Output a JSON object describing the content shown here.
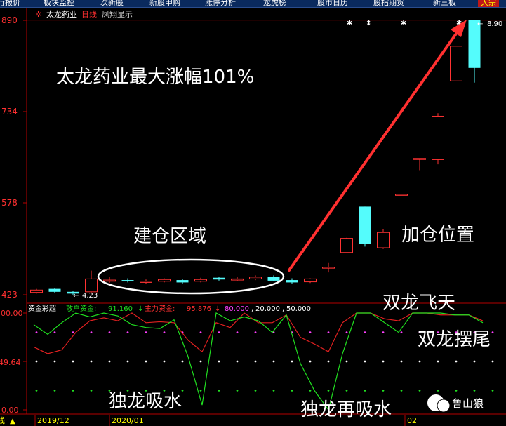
{
  "tabs": [
    {
      "label": "行报价",
      "active": false
    },
    {
      "label": "板块监控",
      "active": false
    },
    {
      "label": "次新股",
      "active": false
    },
    {
      "label": "新股申购",
      "active": false
    },
    {
      "label": "涨停分析",
      "active": false
    },
    {
      "label": "龙虎榜",
      "active": false
    },
    {
      "label": "股市日历",
      "active": false
    },
    {
      "label": "股指期货",
      "active": false
    },
    {
      "label": "新三板",
      "active": false
    },
    {
      "label": "大宗",
      "active": true
    }
  ],
  "chart_header": {
    "title": "太龙药业",
    "period": "日线",
    "mode": "凤翔显示"
  },
  "price_axis": {
    "labels": [
      "890",
      "734",
      "578",
      "423"
    ]
  },
  "last_price": "8.90",
  "low_mark": "4.23",
  "indicator": {
    "name": "资金彩超",
    "sanhu_label": "散户资金:",
    "sanhu_value": "91.160",
    "zhuli_label": "主力资金:",
    "zhuli_value": "95.876",
    "levels": [
      "80.000",
      "20.000",
      "50.000"
    ],
    "axis_labels": [
      "100.00",
      "49.64",
      "0.00"
    ]
  },
  "time_axis": {
    "labels": [
      "2019/12",
      "2020/01",
      "02"
    ]
  },
  "annotations": {
    "max_gain": "太龙药业最大涨幅101%",
    "build_zone": "建仓区域",
    "add_position": "加仓位置",
    "double_dragon_fly": "双龙飞天",
    "double_dragon_swing": "双龙摆尾",
    "single_dragon": "独龙吸水",
    "single_dragon_again": "独龙再吸水",
    "watermark": "鲁山狼"
  },
  "colors": {
    "up": "#ff3232",
    "down": "#54fcfc",
    "green_line": "#20e020",
    "red_line": "#e02020",
    "arrow": "#ff3030",
    "axis_red": "#b40000"
  },
  "chart_data": {
    "type": "candlestick",
    "price_range": [
      4.23,
      8.9
    ],
    "candles": [
      {
        "o": 4.27,
        "c": 4.31,
        "h": 4.33,
        "l": 4.25
      },
      {
        "o": 4.33,
        "c": 4.28,
        "h": 4.35,
        "l": 4.26
      },
      {
        "o": 4.28,
        "c": 4.25,
        "h": 4.3,
        "l": 4.23
      },
      {
        "o": 4.28,
        "c": 4.5,
        "h": 4.64,
        "l": 4.26
      },
      {
        "o": 4.46,
        "c": 4.48,
        "h": 4.53,
        "l": 4.43
      },
      {
        "o": 4.48,
        "c": 4.46,
        "h": 4.51,
        "l": 4.44
      },
      {
        "o": 4.44,
        "c": 4.46,
        "h": 4.49,
        "l": 4.42
      },
      {
        "o": 4.46,
        "c": 4.49,
        "h": 4.51,
        "l": 4.44
      },
      {
        "o": 4.48,
        "c": 4.44,
        "h": 4.5,
        "l": 4.42
      },
      {
        "o": 4.46,
        "c": 4.49,
        "h": 4.52,
        "l": 4.44
      },
      {
        "o": 4.52,
        "c": 4.49,
        "h": 4.54,
        "l": 4.47
      },
      {
        "o": 4.48,
        "c": 4.5,
        "h": 4.53,
        "l": 4.46
      },
      {
        "o": 4.5,
        "c": 4.53,
        "h": 4.56,
        "l": 4.48
      },
      {
        "o": 4.53,
        "c": 4.47,
        "h": 4.56,
        "l": 4.46
      },
      {
        "o": 4.48,
        "c": 4.44,
        "h": 4.51,
        "l": 4.42
      },
      {
        "o": 4.45,
        "c": 4.5,
        "h": 4.51,
        "l": 4.43
      },
      {
        "o": 4.69,
        "c": 4.7,
        "h": 4.77,
        "l": 4.61
      },
      {
        "o": 4.95,
        "c": 5.19,
        "h": 5.2,
        "l": 4.94
      },
      {
        "o": 5.73,
        "c": 5.1,
        "h": 5.73,
        "l": 5.05
      },
      {
        "o": 5.03,
        "c": 5.29,
        "h": 5.35,
        "l": 5.01
      },
      {
        "o": 5.93,
        "c": 5.94,
        "h": 5.94,
        "l": 5.92
      },
      {
        "o": 6.54,
        "c": 6.55,
        "h": 6.55,
        "l": 6.35
      },
      {
        "o": 6.53,
        "c": 7.27,
        "h": 7.32,
        "l": 6.45
      },
      {
        "o": 7.87,
        "c": 8.46,
        "h": 8.46,
        "l": 7.87
      },
      {
        "o": 8.9,
        "c": 8.09,
        "h": 8.91,
        "l": 7.84
      }
    ],
    "indicator_series": [
      {
        "name": "散户资金",
        "color": "green",
        "values": [
          88,
          78,
          90,
          100,
          96,
          100,
          97,
          88,
          85,
          84,
          93,
          55,
          5,
          100,
          92,
          96,
          92,
          80,
          98,
          48,
          20,
          0,
          58,
          100,
          100,
          90,
          80,
          100,
          100,
          100,
          98,
          98,
          90
        ]
      },
      {
        "name": "主力资金",
        "color": "red",
        "values": [
          65,
          58,
          62,
          80,
          92,
          95,
          92,
          100,
          90,
          91,
          90,
          72,
          60,
          90,
          85,
          100,
          90,
          90,
          98,
          75,
          68,
          60,
          90,
          100,
          100,
          94,
          92,
          100,
          100,
          98,
          98,
          98,
          92
        ]
      }
    ],
    "indicator_range": [
      0,
      100
    ]
  }
}
